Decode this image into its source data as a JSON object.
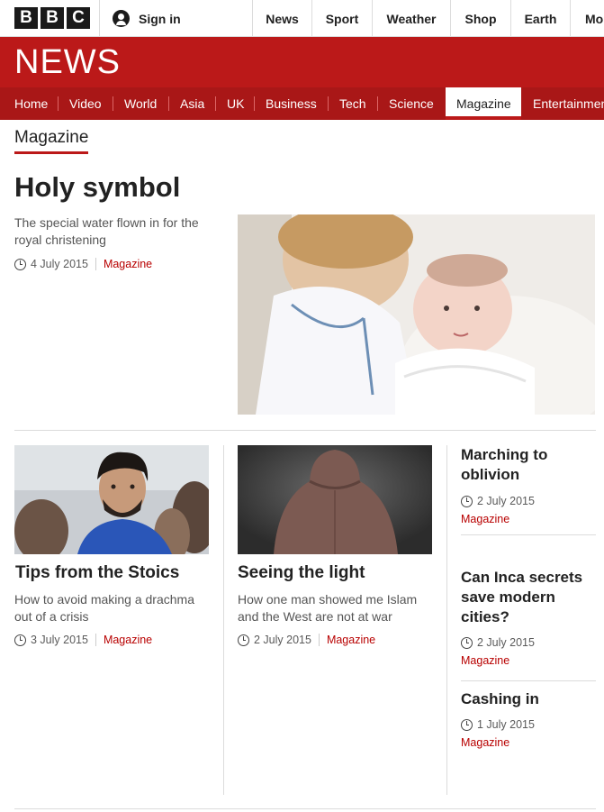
{
  "brand": {
    "logo_letters": [
      "B",
      "B",
      "C"
    ],
    "wordmark": "NEWS",
    "red": "#bb1919"
  },
  "account": {
    "sign_in_label": "Sign in",
    "icon": "user-icon"
  },
  "top_nav": [
    "News",
    "Sport",
    "Weather",
    "Shop",
    "Earth",
    "Mor"
  ],
  "section_nav": [
    "Home",
    "Video",
    "World",
    "Asia",
    "UK",
    "Business",
    "Tech",
    "Science",
    "Magazine",
    "Entertainmen"
  ],
  "active_section": "Magazine",
  "page_heading": "Magazine",
  "top_story": {
    "title": "Holy symbol",
    "summary": "The special water flown in for the royal christening",
    "date": "4 July 2015",
    "tag": "Magazine",
    "image": "baby-and-toddler-photo"
  },
  "cards": [
    {
      "title": "Tips from the Stoics",
      "summary": "How to avoid making a drachma out of a crisis",
      "date": "3 July 2015",
      "tag": "Magazine",
      "image": "man-in-crowd-photo"
    },
    {
      "title": "Seeing the light",
      "summary": "How one man showed me Islam and the West are not at war",
      "date": "2 July 2015",
      "tag": "Magazine",
      "image": "hooded-figure-photo"
    }
  ],
  "side_stories": [
    {
      "title": "Marching to oblivion",
      "date": "2 July 2015",
      "tag": "Magazine"
    },
    {
      "title": "Can Inca secrets save modern cities?",
      "date": "2 July 2015",
      "tag": "Magazine"
    },
    {
      "title": "Cashing in",
      "date": "1 July 2015",
      "tag": "Magazine"
    }
  ]
}
